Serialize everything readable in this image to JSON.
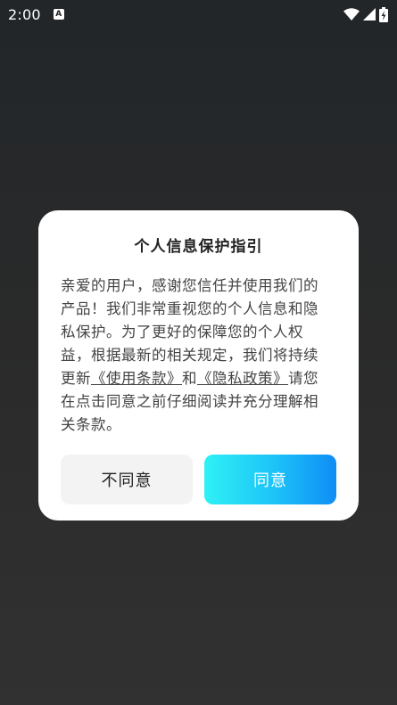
{
  "status_bar": {
    "time": "2:00",
    "notif_icon_text": "A",
    "icons": [
      "wifi-icon",
      "signal-icon",
      "battery-charging-icon"
    ],
    "text_color": "#ffffff"
  },
  "dialog": {
    "title": "个人信息保护指引",
    "body": {
      "part1": "亲爱的用户，感谢您信任并使用我们的产品！我们非常重视您的个人信息和隐私保护。为了更好的保障您的个人权益，根据最新的相关规定，我们将持续更新",
      "link_terms": "《使用条款》",
      "connector": "和",
      "link_privacy": "《隐私政策》",
      "part2": "请您在点击同意之前仔细阅读并充分理解相关条款。"
    },
    "buttons": {
      "disagree": "不同意",
      "agree": "同意"
    }
  },
  "colors": {
    "agree_gradient_start": "#2ff1f5",
    "agree_gradient_end": "#0f8df5",
    "disagree_bg": "#f3f3f3",
    "dialog_bg": "#ffffff"
  }
}
